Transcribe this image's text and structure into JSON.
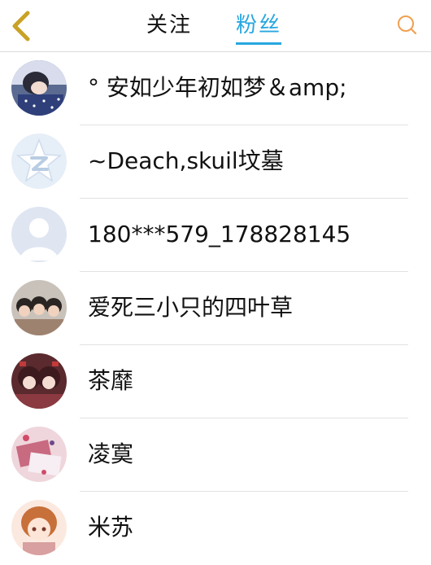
{
  "header": {
    "tabs": [
      {
        "label": "关注",
        "active": false
      },
      {
        "label": "粉丝",
        "active": true
      }
    ],
    "back_icon": "chevron-left-icon",
    "search_icon": "search-icon",
    "accent_color": "#27a7e0",
    "back_icon_color": "#c9a227",
    "search_icon_color": "#f0a050"
  },
  "fans": [
    {
      "name": "° 安如少年初如梦＆amp;",
      "avatar": "photo-avatar"
    },
    {
      "name": "~Deach,skuil坟墓",
      "avatar": "default-star-avatar"
    },
    {
      "name": "180***579_178828145",
      "avatar": "default-person-avatar"
    },
    {
      "name": "爱死三小只的四叶草",
      "avatar": "photo-avatar"
    },
    {
      "name": "茶靡",
      "avatar": "photo-avatar"
    },
    {
      "name": "凌寞",
      "avatar": "photo-avatar"
    },
    {
      "name": "米苏",
      "avatar": "photo-avatar"
    }
  ]
}
